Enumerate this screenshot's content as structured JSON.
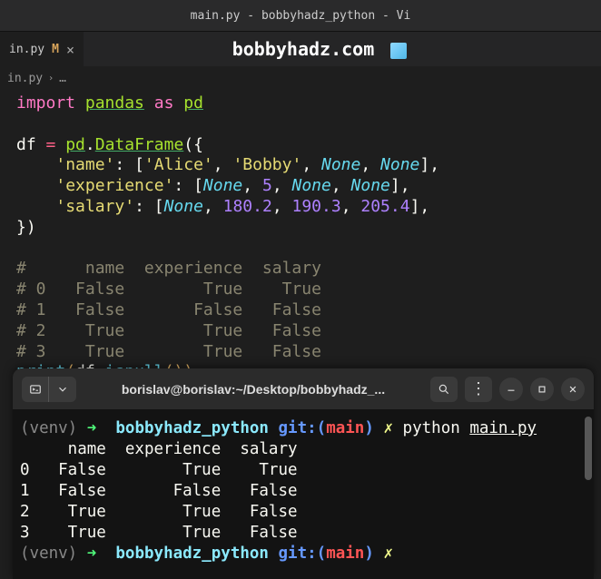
{
  "window": {
    "title": "main.py - bobbyhadz_python - Vi"
  },
  "tab": {
    "filename": "in.py",
    "modified_badge": "M",
    "close": "×"
  },
  "banner": {
    "text": "bobbyhadz.com"
  },
  "breadcrumb": {
    "file": "in.py",
    "sep": "›",
    "more": "…"
  },
  "code": {
    "l1": {
      "import": "import",
      "pandas": "pandas",
      "as": "as",
      "pd": "pd"
    },
    "l2": {
      "df": "df",
      "eq": "=",
      "pd": "pd",
      "dot": ".",
      "cls": "DataFrame",
      "open": "({"
    },
    "l3": {
      "key": "'name'",
      "colon": ": [",
      "v1": "'Alice'",
      "c": ", ",
      "v2": "'Bobby'",
      "v3": "None",
      "v4": "None",
      "end": "],"
    },
    "l4": {
      "key": "'experience'",
      "colon": ": [",
      "v1": "None",
      "c": ", ",
      "v2": "5",
      "v3": "None",
      "v4": "None",
      "end": "],"
    },
    "l5": {
      "key": "'salary'",
      "colon": ": [",
      "v1": "None",
      "c": ", ",
      "v2": "180.2",
      "v3": "190.3",
      "v4": "205.4",
      "end": "],"
    },
    "l6": {
      "close": "})"
    },
    "cm1": "#      name  experience  salary",
    "cm2": "# 0   False        True    True",
    "cm3": "# 1   False       False   False",
    "cm4": "# 2    True        True   False",
    "cm5": "# 3    True        True   False",
    "l7": {
      "print": "print",
      "open": "(",
      "df": "df",
      "dot": ".",
      "fn": "isnull",
      "call": "())"
    }
  },
  "terminal": {
    "title": "borislav@borislav:~/Desktop/bobbyhadz_...",
    "prompt": {
      "venv": "(venv)",
      "arrow": "➜",
      "dir": "bobbyhadz_python",
      "git": "git:(",
      "branch": "main",
      "gitend": ")",
      "dirty": "✗"
    },
    "cmd": {
      "python": "python",
      "file": "main.py"
    },
    "out0": "     name  experience  salary",
    "out1": "0   False        True    True",
    "out2": "1   False       False   False",
    "out3": "2    True        True   False",
    "out4": "3    True        True   False"
  }
}
